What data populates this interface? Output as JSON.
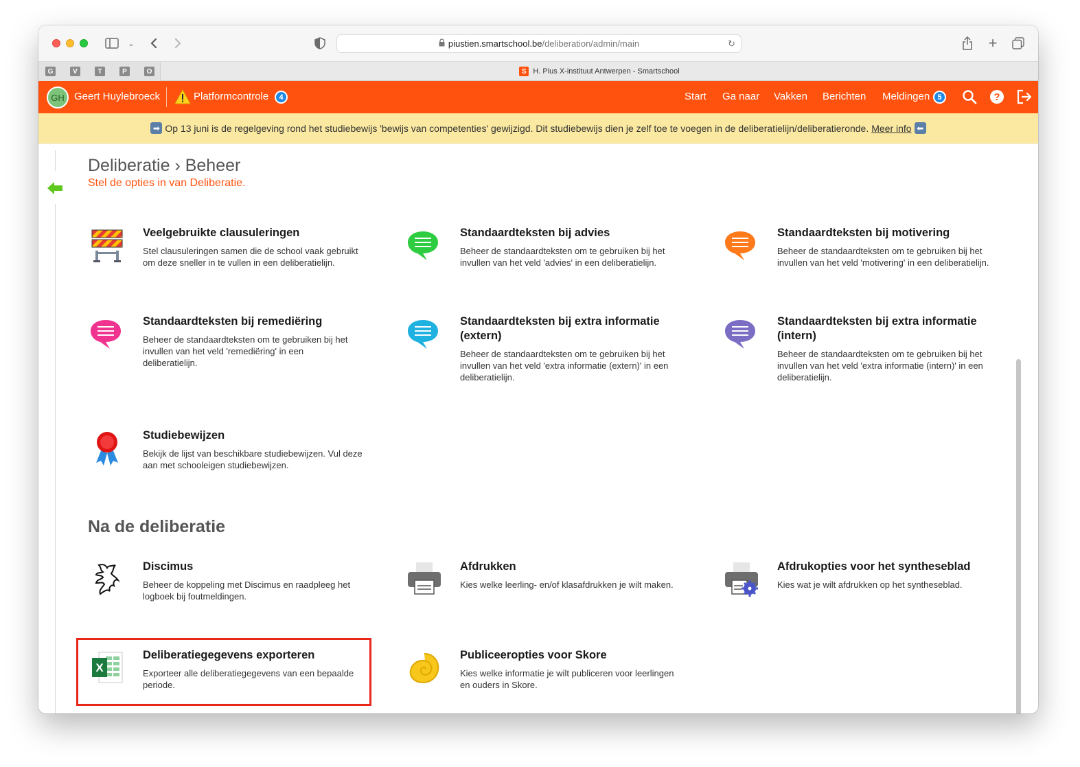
{
  "browser": {
    "url_host": "piustien.smartschool.be",
    "url_path": "/deliberation/admin/main",
    "pinned_tabs": [
      "G",
      "V",
      "T",
      "P",
      "O"
    ],
    "tab_title": "H. Pius X-instituut Antwerpen - Smartschool",
    "tab_logo": "S"
  },
  "header": {
    "initials": "GH",
    "user_name": "Geert Huylebroeck",
    "platform_label": "Platformcontrole",
    "platform_count": "4",
    "nav": {
      "start": "Start",
      "goto": "Ga naar",
      "courses": "Vakken",
      "messages": "Berichten",
      "notifications": "Meldingen"
    },
    "notifications_count": "5"
  },
  "banner": {
    "text": "Op 13 juni is de regelgeving rond het studiebewijs 'bewijs van competenties' gewijzigd. Dit studiebewijs dien je zelf toe te voegen in de deliberatielijn/deliberatieronde.",
    "link": "Meer info"
  },
  "page": {
    "title": "Deliberatie › Beheer",
    "subtitle": "Stel de opties in van Deliberatie.",
    "section2_title": "Na de deliberatie"
  },
  "items": {
    "clauses": {
      "title": "Veelgebruikte clausuleringen",
      "desc1": "Stel clausuleringen samen die de school vaak gebruikt",
      "desc2": "om deze sneller in te vullen in een deliberatielijn."
    },
    "advice": {
      "title": "Standaardteksten bij advies",
      "desc1": "Beheer de standaardteksten om te gebruiken bij het",
      "desc2": "invullen van het veld 'advies' in een deliberatielijn."
    },
    "motivation": {
      "title": "Standaardteksten bij motivering",
      "desc1": "Beheer de standaardteksten om te gebruiken bij het",
      "desc2": "invullen van het veld 'motivering' in een deliberatielijn."
    },
    "remediation": {
      "title": "Standaardteksten bij remediëring",
      "desc1": "Beheer de standaardteksten om te gebruiken bij het",
      "desc2": "invullen van het veld 'remediëring' in een",
      "desc3": "deliberatielijn."
    },
    "extern": {
      "title1": "Standaardteksten bij extra informatie",
      "title2": "(extern)",
      "desc1": "Beheer de standaardteksten om te gebruiken bij het",
      "desc2": "invullen van het veld 'extra informatie (extern)' in een",
      "desc3": "deliberatielijn."
    },
    "intern": {
      "title1": "Standaardteksten bij extra informatie",
      "title2": "(intern)",
      "desc1": "Beheer de standaardteksten om te gebruiken bij het",
      "desc2": "invullen van het veld 'extra informatie (intern)' in een",
      "desc3": "deliberatielijn."
    },
    "certificates": {
      "title": "Studiebewijzen",
      "desc1": "Bekijk de lijst van beschikbare studiebewijzen. Vul deze",
      "desc2": "aan met schooleigen studiebewijzen."
    },
    "discimus": {
      "title": "Discimus",
      "desc1": "Beheer de koppeling met Discimus en raadpleeg het",
      "desc2": "logboek bij foutmeldingen."
    },
    "print": {
      "title": "Afdrukken",
      "desc1": "Kies welke leerling- en/of klasafdrukken je wilt maken."
    },
    "print_options": {
      "title": "Afdrukopties voor het syntheseblad",
      "desc1": "Kies wat je wilt afdrukken op het syntheseblad."
    },
    "export": {
      "title": "Deliberatiegegevens exporteren",
      "desc1": "Exporteer alle deliberatiegegevens van een bepaalde",
      "desc2": "periode."
    },
    "publish": {
      "title": "Publiceeropties voor Skore",
      "desc1": "Kies welke informatie je wilt publiceren voor leerlingen",
      "desc2": "en ouders in Skore."
    }
  },
  "colors": {
    "brand": "#ff520e",
    "banner_bg": "#fbe9a2",
    "highlight": "#e8261a",
    "bubble_green": "#2ecc40",
    "bubble_orange": "#ff7a1a",
    "bubble_pink": "#f0338f",
    "bubble_cyan": "#1fb1e0",
    "bubble_purple": "#7b6cc4"
  }
}
